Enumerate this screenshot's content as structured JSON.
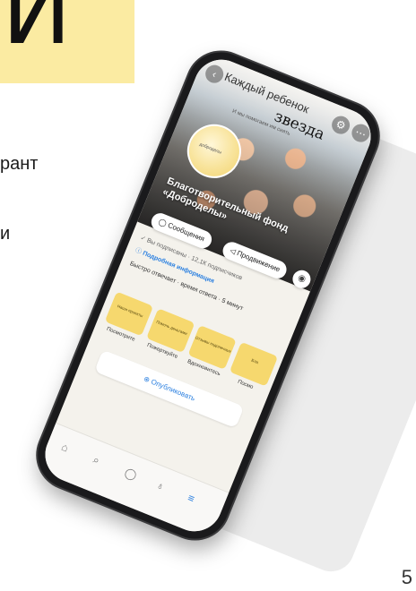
{
  "slide": {
    "big_letter": "И",
    "side_text_1": "рант",
    "side_text_2": "и",
    "page_number": "5"
  },
  "phone": {
    "header": {
      "line1": "Каждый ребенок",
      "line2": "звезда",
      "line3": "И мы помогаем им сиять"
    },
    "avatar_label": "доброделы",
    "org_name": "Благотворительный фонд «Доброделы»",
    "buttons": {
      "messages": "Сообщения",
      "promotion": "Продвижение"
    },
    "info": {
      "subscribed": "Вы подписаны · 12,1К подписчиков",
      "details": "Подробная информация",
      "reply_time": "Быстро отвечает · время ответа · 5 минут"
    },
    "tiles": [
      {
        "label": "Наши проекты",
        "caption": "Посмотрите"
      },
      {
        "label": "Помочь деньгами",
        "caption": "Пожертвуйте"
      },
      {
        "label": "Отзывы подопечных",
        "caption": "Вдохновитесь"
      },
      {
        "label": "Бла",
        "caption": "Посмо"
      }
    ],
    "publish": "Опубликовать"
  },
  "colors": {
    "accent_yellow": "#fbeba2",
    "tile_yellow": "#f6d86e",
    "link_blue": "#2d81e0"
  }
}
